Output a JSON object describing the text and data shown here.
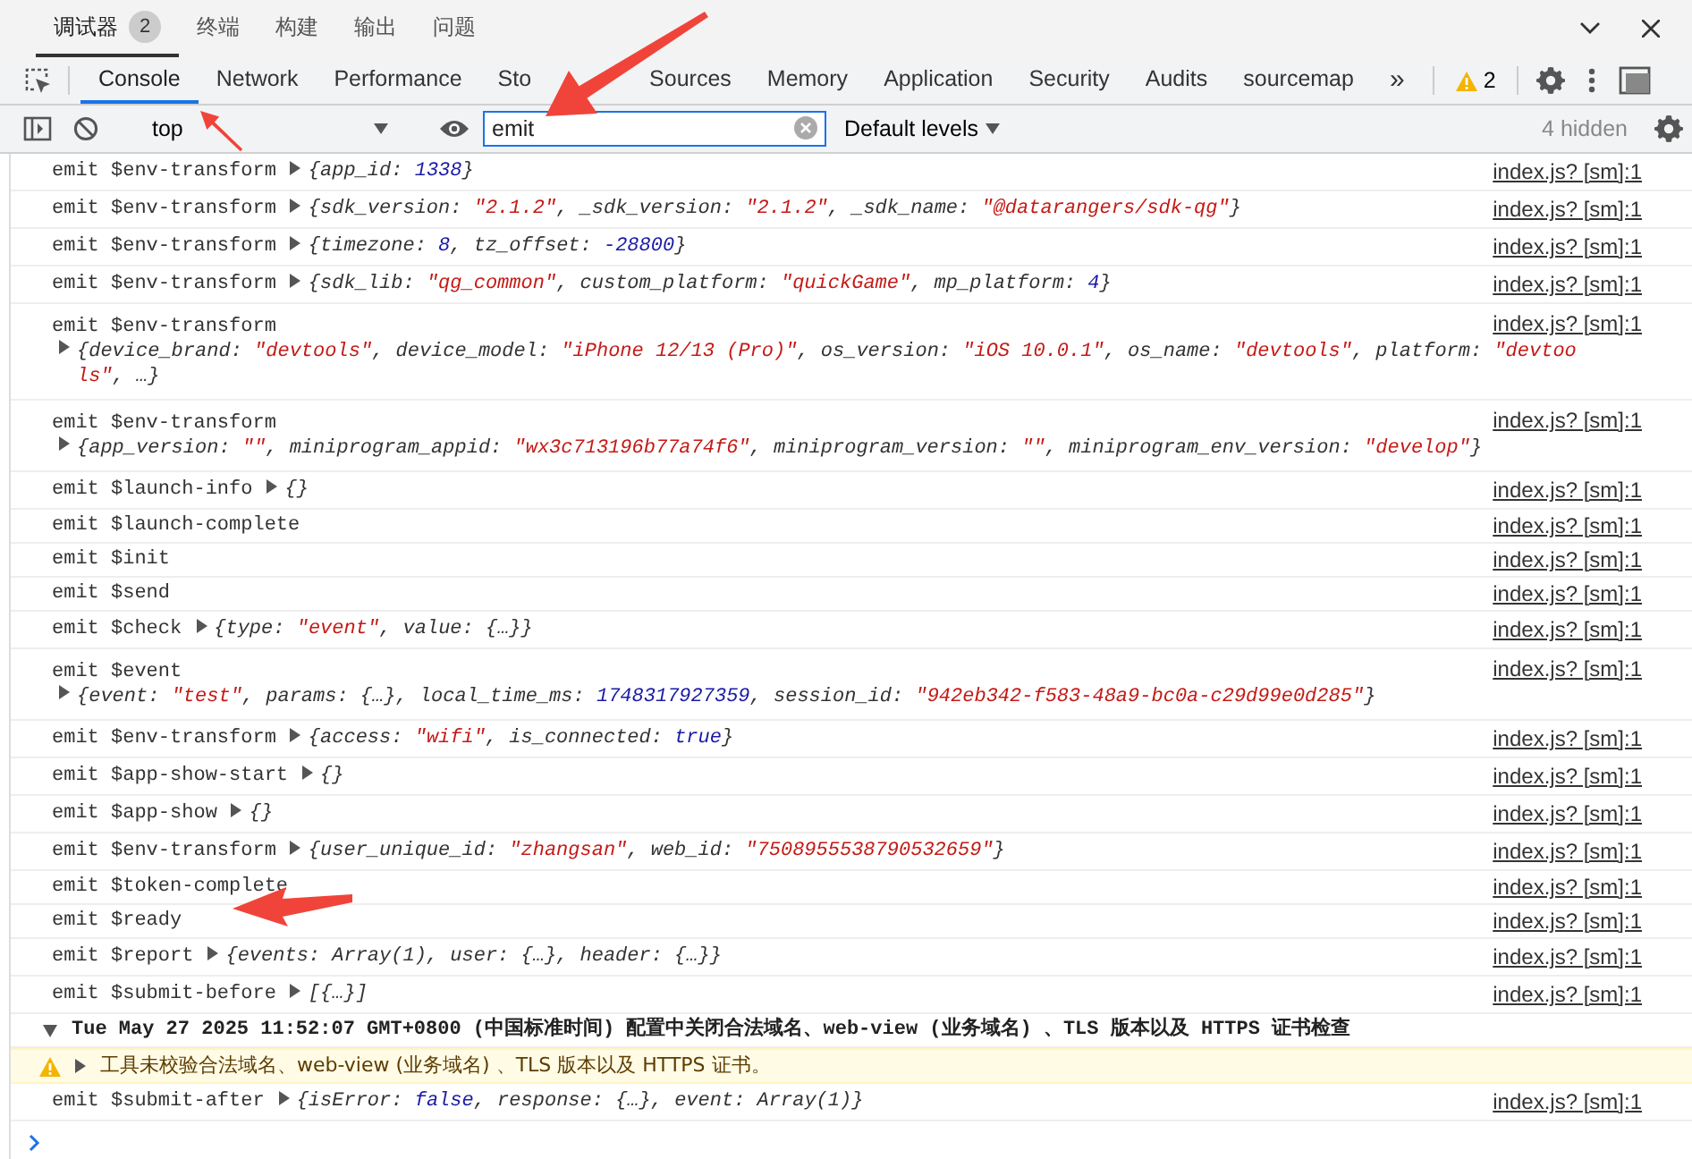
{
  "panel_tabs": [
    {
      "label": "调试器",
      "badge": "2",
      "selected": true
    },
    {
      "label": "终端",
      "selected": false
    },
    {
      "label": "构建",
      "selected": false
    },
    {
      "label": "输出",
      "selected": false
    },
    {
      "label": "问题",
      "selected": false
    }
  ],
  "devtools_tabs": [
    {
      "label": "Console",
      "selected": true
    },
    {
      "label": "Network",
      "selected": false
    },
    {
      "label": "Performance",
      "selected": false
    },
    {
      "label": "Sto",
      "selected": false,
      "covered": true
    },
    {
      "label": "Sources",
      "selected": false
    },
    {
      "label": "Memory",
      "selected": false
    },
    {
      "label": "Application",
      "selected": false
    },
    {
      "label": "Security",
      "selected": false
    },
    {
      "label": "Audits",
      "selected": false
    },
    {
      "label": "sourcemap",
      "selected": false
    }
  ],
  "more_tabs": "»",
  "warning_count": "2",
  "toolbar": {
    "context": "top",
    "filter": "emit",
    "levels": "Default levels",
    "hidden": "4 hidden"
  },
  "messages": [
    {
      "kind": "log",
      "text": "emit $env-transform",
      "object": [
        {
          "kind": "plain",
          "text": "{app_id: "
        },
        {
          "kind": "number",
          "text": "1338"
        },
        {
          "kind": "plain",
          "text": "}"
        }
      ],
      "source": "index.js? [sm]:1"
    },
    {
      "kind": "log",
      "text": "emit $env-transform",
      "object": [
        {
          "kind": "plain",
          "text": "{sdk_version: "
        },
        {
          "kind": "string",
          "text": "\"2.1.2\""
        },
        {
          "kind": "plain",
          "text": ", _sdk_version: "
        },
        {
          "kind": "string",
          "text": "\"2.1.2\""
        },
        {
          "kind": "plain",
          "text": ", _sdk_name: "
        },
        {
          "kind": "string",
          "text": "\"@datarangers/sdk-qg\""
        },
        {
          "kind": "plain",
          "text": "}"
        }
      ],
      "source": "index.js? [sm]:1"
    },
    {
      "kind": "log",
      "text": "emit $env-transform",
      "object": [
        {
          "kind": "plain",
          "text": "{timezone: "
        },
        {
          "kind": "number",
          "text": "8"
        },
        {
          "kind": "plain",
          "text": ", tz_offset: "
        },
        {
          "kind": "number",
          "text": "-28800"
        },
        {
          "kind": "plain",
          "text": "}"
        }
      ],
      "source": "index.js? [sm]:1"
    },
    {
      "kind": "log",
      "text": "emit $env-transform",
      "object": [
        {
          "kind": "plain",
          "text": "{sdk_lib: "
        },
        {
          "kind": "string",
          "text": "\"qg_common\""
        },
        {
          "kind": "plain",
          "text": ", custom_platform: "
        },
        {
          "kind": "string",
          "text": "\"quickGame\""
        },
        {
          "kind": "plain",
          "text": ", mp_platform: "
        },
        {
          "kind": "number",
          "text": "4"
        },
        {
          "kind": "plain",
          "text": "}"
        }
      ],
      "source": "index.js? [sm]:1"
    },
    {
      "kind": "log-wrapped",
      "text": "emit $env-transform",
      "object": [
        {
          "kind": "plain",
          "text": "{device_brand: "
        },
        {
          "kind": "string",
          "text": "\"devtools\""
        },
        {
          "kind": "plain",
          "text": ", device_model: "
        },
        {
          "kind": "string",
          "text": "\"iPhone 12/13 (Pro)\""
        },
        {
          "kind": "plain",
          "text": ", os_version: "
        },
        {
          "kind": "string",
          "text": "\"iOS 10.0.1\""
        },
        {
          "kind": "plain",
          "text": ", os_name: "
        },
        {
          "kind": "string",
          "text": "\"devtools\""
        },
        {
          "kind": "plain",
          "text": ", platform: "
        },
        {
          "kind": "string",
          "text": "\"devtools\""
        },
        {
          "kind": "plain",
          "text": ", …}"
        }
      ],
      "source": "index.js? [sm]:1"
    },
    {
      "kind": "log-wrapped",
      "text": "emit $env-transform",
      "object": [
        {
          "kind": "plain",
          "text": "{app_version: "
        },
        {
          "kind": "string",
          "text": "\"\""
        },
        {
          "kind": "plain",
          "text": ", miniprogram_appid: "
        },
        {
          "kind": "string",
          "text": "\"wx3c713196b77a74f6\""
        },
        {
          "kind": "plain",
          "text": ", miniprogram_version: "
        },
        {
          "kind": "string",
          "text": "\"\""
        },
        {
          "kind": "plain",
          "text": ", miniprogram_env_version: "
        },
        {
          "kind": "string",
          "text": "\"develop\""
        },
        {
          "kind": "plain",
          "text": "}"
        }
      ],
      "source": "index.js? [sm]:1"
    },
    {
      "kind": "log",
      "text": "emit $launch-info",
      "object": [
        {
          "kind": "plain",
          "text": "{}"
        }
      ],
      "source": "index.js? [sm]:1"
    },
    {
      "kind": "log",
      "text": "emit $launch-complete",
      "source": "index.js? [sm]:1"
    },
    {
      "kind": "log",
      "text": "emit $init",
      "source": "index.js? [sm]:1"
    },
    {
      "kind": "log",
      "text": "emit $send",
      "source": "index.js? [sm]:1"
    },
    {
      "kind": "log",
      "text": "emit $check",
      "object": [
        {
          "kind": "plain",
          "text": "{type: "
        },
        {
          "kind": "string",
          "text": "\"event\""
        },
        {
          "kind": "plain",
          "text": ", value: {…}}"
        }
      ],
      "source": "index.js? [sm]:1"
    },
    {
      "kind": "log-wrapped",
      "text": "emit $event",
      "object": [
        {
          "kind": "plain",
          "text": "{event: "
        },
        {
          "kind": "string",
          "text": "\"test\""
        },
        {
          "kind": "plain",
          "text": ", params: {…}, local_time_ms: "
        },
        {
          "kind": "number",
          "text": "1748317927359"
        },
        {
          "kind": "plain",
          "text": ", session_id: "
        },
        {
          "kind": "string",
          "text": "\"942eb342-f583-48a9-bc0a-c29d99e0d285\""
        },
        {
          "kind": "plain",
          "text": "}"
        }
      ],
      "source": "index.js? [sm]:1"
    },
    {
      "kind": "log",
      "text": "emit $env-transform",
      "object": [
        {
          "kind": "plain",
          "text": "{access: "
        },
        {
          "kind": "string",
          "text": "\"wifi\""
        },
        {
          "kind": "plain",
          "text": ", is_connected: "
        },
        {
          "kind": "number",
          "text": "true"
        },
        {
          "kind": "plain",
          "text": "}"
        }
      ],
      "source": "index.js? [sm]:1"
    },
    {
      "kind": "log",
      "text": "emit $app-show-start",
      "object": [
        {
          "kind": "plain",
          "text": "{}"
        }
      ],
      "source": "index.js? [sm]:1"
    },
    {
      "kind": "log",
      "text": "emit $app-show",
      "object": [
        {
          "kind": "plain",
          "text": "{}"
        }
      ],
      "source": "index.js? [sm]:1"
    },
    {
      "kind": "log",
      "text": "emit $env-transform",
      "object": [
        {
          "kind": "plain",
          "text": "{user_unique_id: "
        },
        {
          "kind": "string",
          "text": "\"zhangsan\""
        },
        {
          "kind": "plain",
          "text": ", web_id: "
        },
        {
          "kind": "string",
          "text": "\"7508955538790532659\""
        },
        {
          "kind": "plain",
          "text": "}"
        }
      ],
      "source": "index.js? [sm]:1"
    },
    {
      "kind": "log",
      "text": "emit $token-complete",
      "source": "index.js? [sm]:1"
    },
    {
      "kind": "log",
      "text": "emit $ready",
      "source": "index.js? [sm]:1"
    },
    {
      "kind": "log",
      "text": "emit $report",
      "object": [
        {
          "kind": "plain",
          "text": "{events: Array(1), user: {…}, header: {…}}"
        }
      ],
      "source": "index.js? [sm]:1"
    },
    {
      "kind": "log",
      "text": "emit $submit-before",
      "object": [
        {
          "kind": "plain",
          "text": "[{…}]"
        }
      ],
      "source": "index.js? [sm]:1"
    },
    {
      "kind": "group",
      "expanded": true,
      "text": "Tue May 27 2025 11:52:07 GMT+0800 (中国标准时间) 配置中关闭合法域名、web-view (业务域名) 、TLS 版本以及 HTTPS 证书检查"
    },
    {
      "kind": "warning",
      "text": "工具未校验合法域名、web-view (业务域名) 、TLS 版本以及 HTTPS 证书。"
    },
    {
      "kind": "log",
      "text": "emit $submit-after",
      "object": [
        {
          "kind": "plain",
          "text": "{isError: "
        },
        {
          "kind": "number",
          "text": "false"
        },
        {
          "kind": "plain",
          "text": ", response: {…}, event: Array(1)}"
        }
      ],
      "source": "index.js? [sm]:1"
    }
  ]
}
